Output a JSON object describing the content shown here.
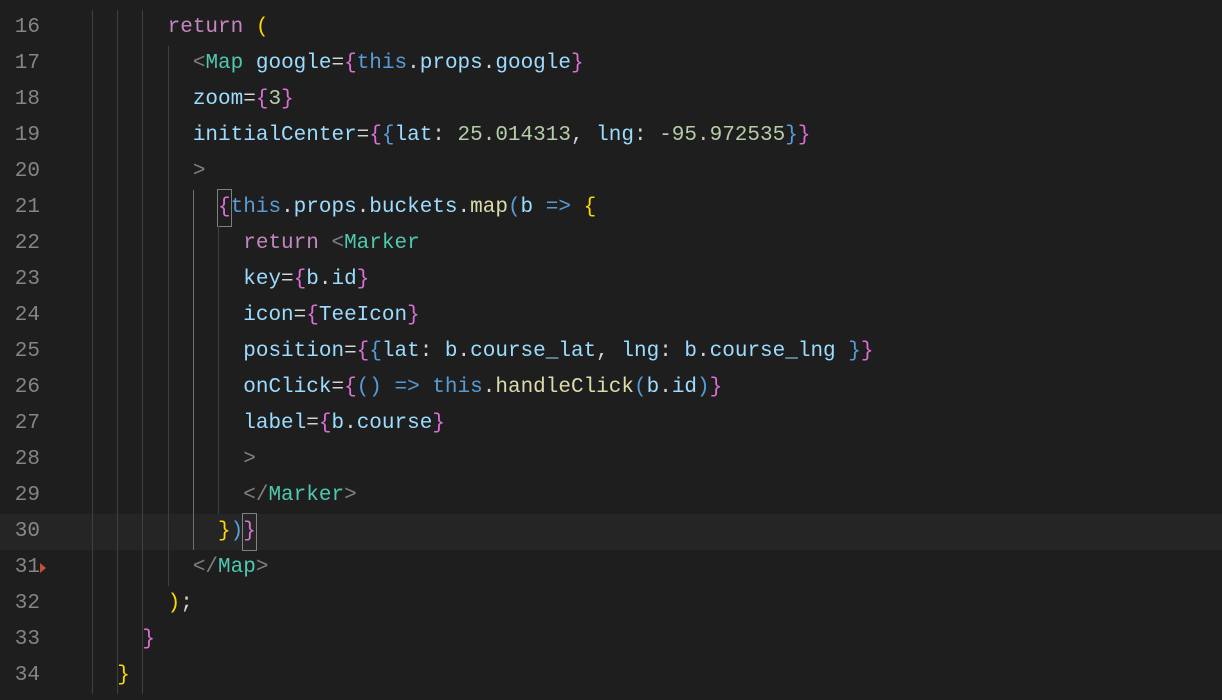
{
  "startLine": 16,
  "highlightedLine": 30,
  "warnMarkerLine": 31,
  "lines": [
    {
      "n": 16,
      "indent": 3,
      "tokens": [
        {
          "t": "return",
          "c": "c-kw"
        },
        {
          "t": " ",
          "c": ""
        },
        {
          "t": "(",
          "c": "c-brace-y"
        }
      ]
    },
    {
      "n": 17,
      "indent": 4,
      "tokens": [
        {
          "t": "<",
          "c": "c-tagbr"
        },
        {
          "t": "Map",
          "c": "c-comp"
        },
        {
          "t": " ",
          "c": ""
        },
        {
          "t": "google",
          "c": "c-attr"
        },
        {
          "t": "=",
          "c": "c-op"
        },
        {
          "t": "{",
          "c": "c-brace-p"
        },
        {
          "t": "this",
          "c": "c-this"
        },
        {
          "t": ".",
          "c": "c-punc"
        },
        {
          "t": "props",
          "c": "c-prop"
        },
        {
          "t": ".",
          "c": "c-punc"
        },
        {
          "t": "google",
          "c": "c-prop"
        },
        {
          "t": "}",
          "c": "c-brace-p"
        }
      ]
    },
    {
      "n": 18,
      "indent": 4,
      "tokens": [
        {
          "t": "zoom",
          "c": "c-attr"
        },
        {
          "t": "=",
          "c": "c-op"
        },
        {
          "t": "{",
          "c": "c-brace-p"
        },
        {
          "t": "3",
          "c": "c-num"
        },
        {
          "t": "}",
          "c": "c-brace-p"
        }
      ]
    },
    {
      "n": 19,
      "indent": 4,
      "tokens": [
        {
          "t": "initialCenter",
          "c": "c-attr"
        },
        {
          "t": "=",
          "c": "c-op"
        },
        {
          "t": "{",
          "c": "c-brace-p"
        },
        {
          "t": "{",
          "c": "c-brace-b"
        },
        {
          "t": "lat",
          "c": "c-prop"
        },
        {
          "t": ":",
          "c": "c-punc"
        },
        {
          "t": " ",
          "c": ""
        },
        {
          "t": "25.014313",
          "c": "c-num"
        },
        {
          "t": ",",
          "c": "c-punc"
        },
        {
          "t": " ",
          "c": ""
        },
        {
          "t": "lng",
          "c": "c-prop"
        },
        {
          "t": ":",
          "c": "c-punc"
        },
        {
          "t": " ",
          "c": ""
        },
        {
          "t": "-95.972535",
          "c": "c-num"
        },
        {
          "t": "}",
          "c": "c-brace-b"
        },
        {
          "t": "}",
          "c": "c-brace-p"
        }
      ]
    },
    {
      "n": 20,
      "indent": 4,
      "tokens": [
        {
          "t": ">",
          "c": "c-tagbr"
        }
      ]
    },
    {
      "n": 21,
      "indent": 5,
      "tokens": [
        {
          "t": "{",
          "c": "c-brace-p",
          "bm": true
        },
        {
          "t": "this",
          "c": "c-this"
        },
        {
          "t": ".",
          "c": "c-punc"
        },
        {
          "t": "props",
          "c": "c-prop"
        },
        {
          "t": ".",
          "c": "c-punc"
        },
        {
          "t": "buckets",
          "c": "c-prop"
        },
        {
          "t": ".",
          "c": "c-punc"
        },
        {
          "t": "map",
          "c": "c-func"
        },
        {
          "t": "(",
          "c": "c-brace-b"
        },
        {
          "t": "b",
          "c": "c-param"
        },
        {
          "t": " ",
          "c": ""
        },
        {
          "t": "=>",
          "c": "c-this"
        },
        {
          "t": " ",
          "c": ""
        },
        {
          "t": "{",
          "c": "c-brace-y"
        }
      ]
    },
    {
      "n": 22,
      "indent": 6,
      "tokens": [
        {
          "t": "return",
          "c": "c-kw"
        },
        {
          "t": " ",
          "c": ""
        },
        {
          "t": "<",
          "c": "c-tagbr"
        },
        {
          "t": "Marker",
          "c": "c-comp"
        }
      ]
    },
    {
      "n": 23,
      "indent": 6,
      "tokens": [
        {
          "t": "key",
          "c": "c-attr"
        },
        {
          "t": "=",
          "c": "c-op"
        },
        {
          "t": "{",
          "c": "c-brace-p"
        },
        {
          "t": "b",
          "c": "c-prop"
        },
        {
          "t": ".",
          "c": "c-punc"
        },
        {
          "t": "id",
          "c": "c-prop"
        },
        {
          "t": "}",
          "c": "c-brace-p"
        }
      ]
    },
    {
      "n": 24,
      "indent": 6,
      "tokens": [
        {
          "t": "icon",
          "c": "c-attr"
        },
        {
          "t": "=",
          "c": "c-op"
        },
        {
          "t": "{",
          "c": "c-brace-p"
        },
        {
          "t": "TeeIcon",
          "c": "c-prop"
        },
        {
          "t": "}",
          "c": "c-brace-p"
        }
      ]
    },
    {
      "n": 25,
      "indent": 6,
      "tokens": [
        {
          "t": "position",
          "c": "c-attr"
        },
        {
          "t": "=",
          "c": "c-op"
        },
        {
          "t": "{",
          "c": "c-brace-p"
        },
        {
          "t": "{",
          "c": "c-brace-b"
        },
        {
          "t": "lat",
          "c": "c-prop"
        },
        {
          "t": ":",
          "c": "c-punc"
        },
        {
          "t": " ",
          "c": ""
        },
        {
          "t": "b",
          "c": "c-prop"
        },
        {
          "t": ".",
          "c": "c-punc"
        },
        {
          "t": "course_lat",
          "c": "c-prop"
        },
        {
          "t": ",",
          "c": "c-punc"
        },
        {
          "t": " ",
          "c": ""
        },
        {
          "t": "lng",
          "c": "c-prop"
        },
        {
          "t": ":",
          "c": "c-punc"
        },
        {
          "t": " ",
          "c": ""
        },
        {
          "t": "b",
          "c": "c-prop"
        },
        {
          "t": ".",
          "c": "c-punc"
        },
        {
          "t": "course_lng",
          "c": "c-prop"
        },
        {
          "t": " ",
          "c": ""
        },
        {
          "t": "}",
          "c": "c-brace-b"
        },
        {
          "t": "}",
          "c": "c-brace-p"
        }
      ]
    },
    {
      "n": 26,
      "indent": 6,
      "tokens": [
        {
          "t": "onClick",
          "c": "c-attr"
        },
        {
          "t": "=",
          "c": "c-op"
        },
        {
          "t": "{",
          "c": "c-brace-p"
        },
        {
          "t": "(",
          "c": "c-brace-b"
        },
        {
          "t": ")",
          "c": "c-brace-b"
        },
        {
          "t": " ",
          "c": ""
        },
        {
          "t": "=>",
          "c": "c-this"
        },
        {
          "t": " ",
          "c": ""
        },
        {
          "t": "this",
          "c": "c-this"
        },
        {
          "t": ".",
          "c": "c-punc"
        },
        {
          "t": "handleClick",
          "c": "c-func"
        },
        {
          "t": "(",
          "c": "c-brace-b"
        },
        {
          "t": "b",
          "c": "c-prop"
        },
        {
          "t": ".",
          "c": "c-punc"
        },
        {
          "t": "id",
          "c": "c-prop"
        },
        {
          "t": ")",
          "c": "c-brace-b"
        },
        {
          "t": "}",
          "c": "c-brace-p"
        }
      ]
    },
    {
      "n": 27,
      "indent": 6,
      "tokens": [
        {
          "t": "label",
          "c": "c-attr"
        },
        {
          "t": "=",
          "c": "c-op"
        },
        {
          "t": "{",
          "c": "c-brace-p"
        },
        {
          "t": "b",
          "c": "c-prop"
        },
        {
          "t": ".",
          "c": "c-punc"
        },
        {
          "t": "course",
          "c": "c-prop"
        },
        {
          "t": "}",
          "c": "c-brace-p"
        }
      ]
    },
    {
      "n": 28,
      "indent": 6,
      "tokens": [
        {
          "t": ">",
          "c": "c-tagbr"
        }
      ]
    },
    {
      "n": 29,
      "indent": 6,
      "tokens": [
        {
          "t": "</",
          "c": "c-tagbr"
        },
        {
          "t": "Marker",
          "c": "c-comp"
        },
        {
          "t": ">",
          "c": "c-tagbr"
        }
      ]
    },
    {
      "n": 30,
      "indent": 5,
      "tokens": [
        {
          "t": "}",
          "c": "c-brace-y"
        },
        {
          "t": ")",
          "c": "c-brace-b"
        },
        {
          "t": "}",
          "c": "c-brace-p",
          "bm": true
        }
      ]
    },
    {
      "n": 31,
      "indent": 4,
      "tokens": [
        {
          "t": "</",
          "c": "c-tagbr"
        },
        {
          "t": "Map",
          "c": "c-comp"
        },
        {
          "t": ">",
          "c": "c-tagbr"
        }
      ]
    },
    {
      "n": 32,
      "indent": 3,
      "tokens": [
        {
          "t": ")",
          "c": "c-brace-y"
        },
        {
          "t": ";",
          "c": "c-punc"
        }
      ]
    },
    {
      "n": 33,
      "indent": 2,
      "tokens": [
        {
          "t": "}",
          "c": "c-brace-p"
        }
      ]
    },
    {
      "n": 34,
      "indent": 1,
      "tokens": [
        {
          "t": "}",
          "c": "c-brace-y"
        }
      ]
    }
  ],
  "indentGuidesBase": [
    0,
    1,
    2
  ],
  "indentWidthPx": 25.2,
  "extraGuides": {
    "17": [
      3
    ],
    "18": [
      3
    ],
    "19": [
      3
    ],
    "20": [
      3
    ],
    "21": [
      3,
      4
    ],
    "22": [
      3,
      4,
      5
    ],
    "23": [
      3,
      4,
      5
    ],
    "24": [
      3,
      4,
      5
    ],
    "25": [
      3,
      4,
      5
    ],
    "26": [
      3,
      4,
      5
    ],
    "27": [
      3,
      4,
      5
    ],
    "28": [
      3,
      4,
      5
    ],
    "29": [
      3,
      4,
      5
    ],
    "30": [
      3,
      4
    ],
    "31": [
      3
    ]
  },
  "activeGuideLevel": 4,
  "activeGuideLines": [
    21,
    22,
    23,
    24,
    25,
    26,
    27,
    28,
    29,
    30
  ]
}
